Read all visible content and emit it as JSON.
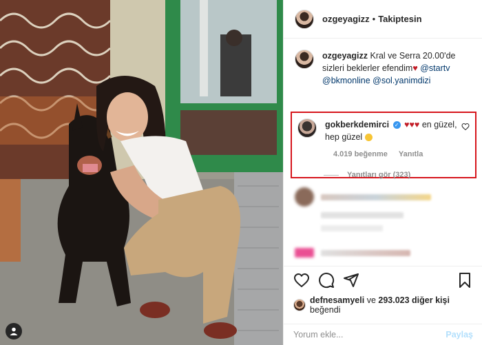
{
  "post": {
    "username": "ozgeyagizz",
    "separator": "•",
    "follow_status": "Takiptesin"
  },
  "caption": {
    "username": "ozgeyagizz",
    "text": "Kral ve Serra 20.00'de sizleri beklerler efendim",
    "heart": "♥",
    "mentions": [
      "@startv",
      "@bkmonline",
      "@sol.yanimdizi"
    ]
  },
  "highlighted_comment": {
    "username": "gokberkdemirci",
    "verified_glyph": "✓",
    "hearts": "♥♥♥",
    "text_after": "en güzel, hep güzel",
    "likes": "4.019 beğenme",
    "reply_label": "Yanıtla",
    "view_replies": "Yanıtları gör (323)",
    "highlight_color": "#d6141b"
  },
  "likes_line": {
    "first_liker": "defnesamyeli",
    "connector": "ve",
    "others": "293.023 diğer kişi",
    "suffix": "beğendi"
  },
  "comment_input": {
    "placeholder": "Yorum ekle...",
    "post_label": "Paylaş"
  },
  "icons": [
    "heart-icon",
    "comment-icon",
    "share-icon",
    "bookmark-icon",
    "user-tag-icon"
  ],
  "colors": {
    "link": "#00376b",
    "muted": "#8e8e8e",
    "verified": "#3897f0",
    "post_button": "#b2dffc"
  }
}
